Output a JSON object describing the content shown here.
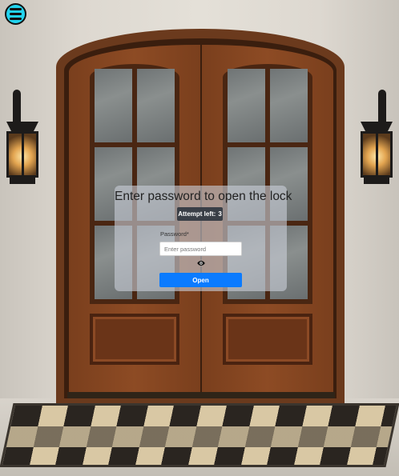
{
  "dialog": {
    "title": "Enter password to open the lock",
    "attempts_label": "Attempt left:",
    "attempts_value": "3",
    "password_label": "Password*",
    "password_placeholder": "Enter password",
    "password_value": "",
    "open_label": "Open"
  },
  "icons": {
    "menu": "hamburger-menu-icon",
    "visibility": "eye-icon"
  },
  "colors": {
    "menu_button": "#22d3ee",
    "open_button": "#0b7bff",
    "attempts_badge": "#3a3f47"
  }
}
